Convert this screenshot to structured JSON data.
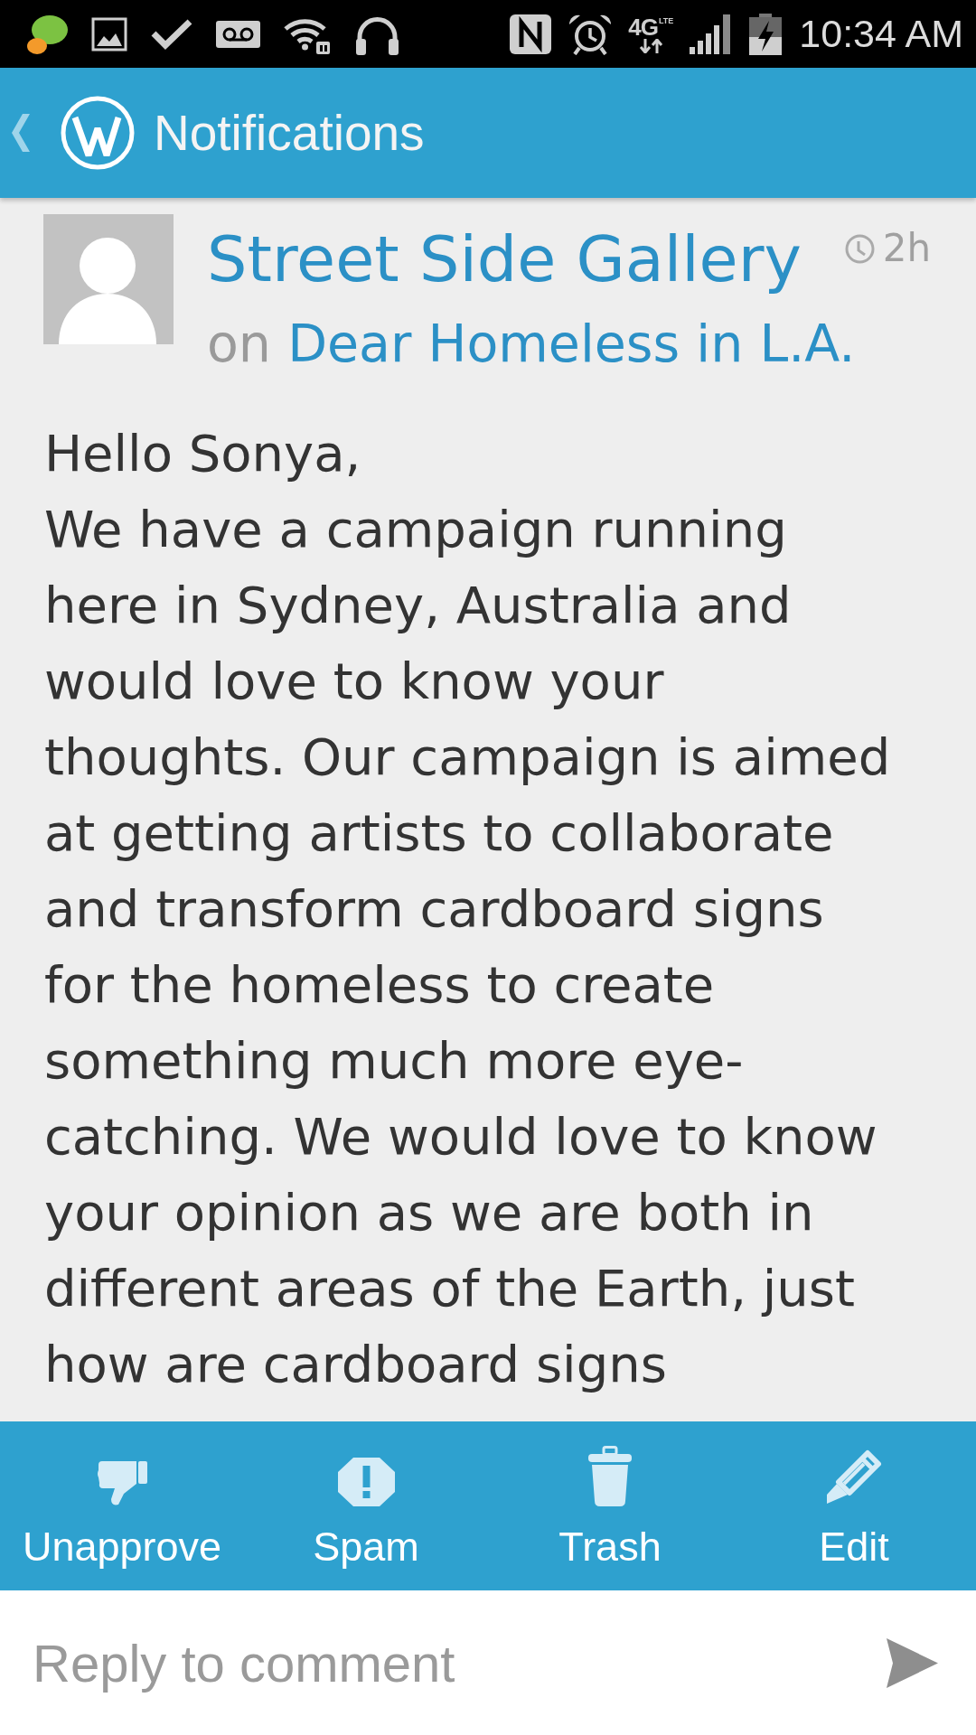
{
  "status_bar": {
    "network": "4G",
    "network_detail": "LTE",
    "time": "10:34 AM"
  },
  "header": {
    "title": "Notifications"
  },
  "comment": {
    "author": "Street Side Gallery",
    "age": "2h",
    "preposition": "on",
    "post_title": "Dear Homeless in L.A.",
    "greeting": "Hello Sonya,",
    "body": "We have a campaign running here in Sydney, Australia and would love to know your thoughts. Our campaign is aimed at getting artists to collaborate and transform cardboard signs for the homeless to create something much more eye-catching. We would love to know your opinion as we are both in different areas of the Earth, just how are cardboard signs"
  },
  "actions": [
    {
      "kind": "unapprove",
      "label": "Unapprove"
    },
    {
      "kind": "spam",
      "label": "Spam"
    },
    {
      "kind": "trash",
      "label": "Trash"
    },
    {
      "kind": "edit",
      "label": "Edit"
    }
  ],
  "reply": {
    "placeholder": "Reply to comment"
  }
}
